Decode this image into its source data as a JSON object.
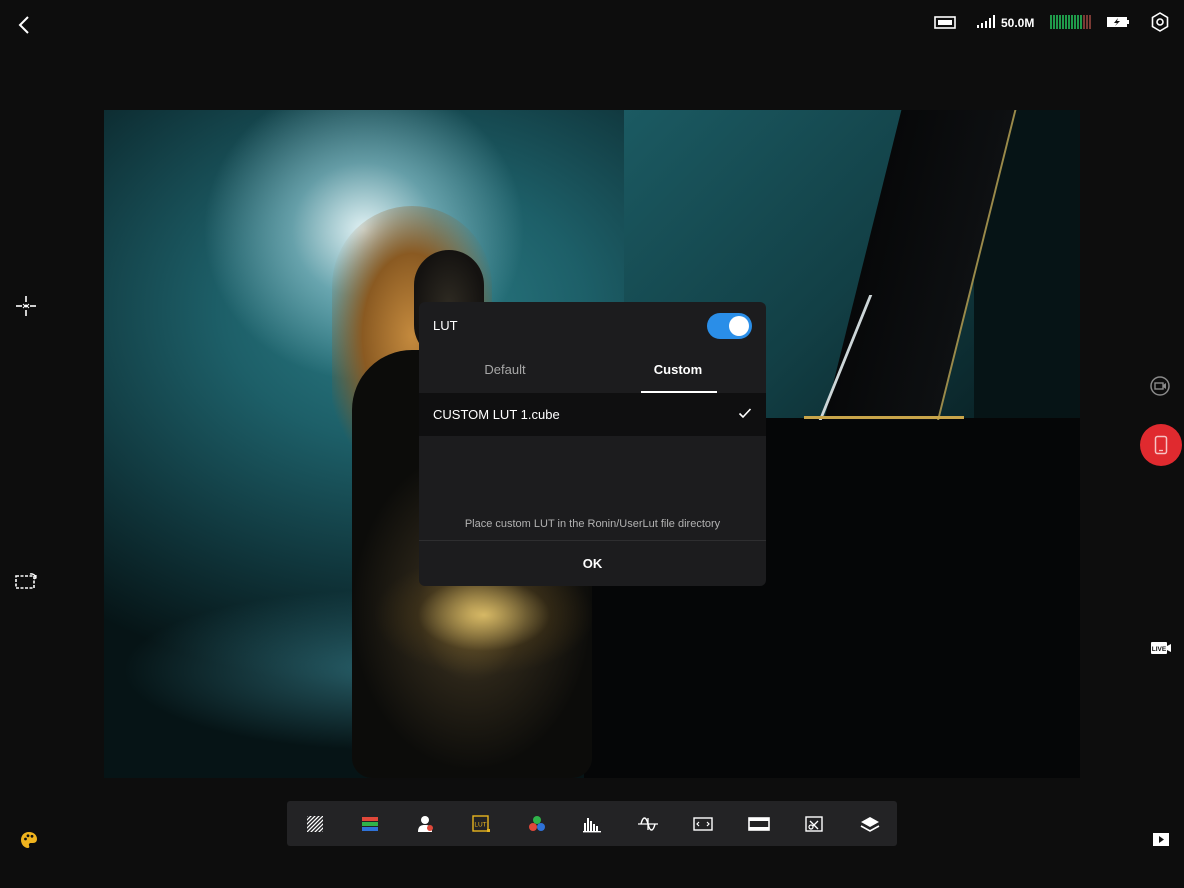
{
  "status_bar": {
    "storage_remaining": "50.0M"
  },
  "lut_dialog": {
    "title": "LUT",
    "enabled": true,
    "tabs": [
      {
        "label": "Default",
        "active": false
      },
      {
        "label": "Custom",
        "active": true
      }
    ],
    "items": [
      {
        "name": "CUSTOM LUT 1.cube",
        "selected": true
      }
    ],
    "hint": "Place custom LUT in the Ronin/UserLut file directory",
    "ok_label": "OK"
  },
  "toolbar": {
    "tools": [
      "zebra-icon",
      "false-color-icon",
      "skin-tone-icon",
      "lut-icon",
      "color-picker-icon",
      "histogram-icon",
      "waveform-icon",
      "frame-guide-icon",
      "aspect-ratio-icon",
      "anamorphic-icon",
      "layers-icon"
    ],
    "lut_tool_label": "LUT"
  },
  "side_controls": {
    "live_label": "LIVE"
  },
  "colors": {
    "accent_blue": "#2a8ee8",
    "record_red": "#e02a2f",
    "lut_yellow": "#e8b51f"
  }
}
